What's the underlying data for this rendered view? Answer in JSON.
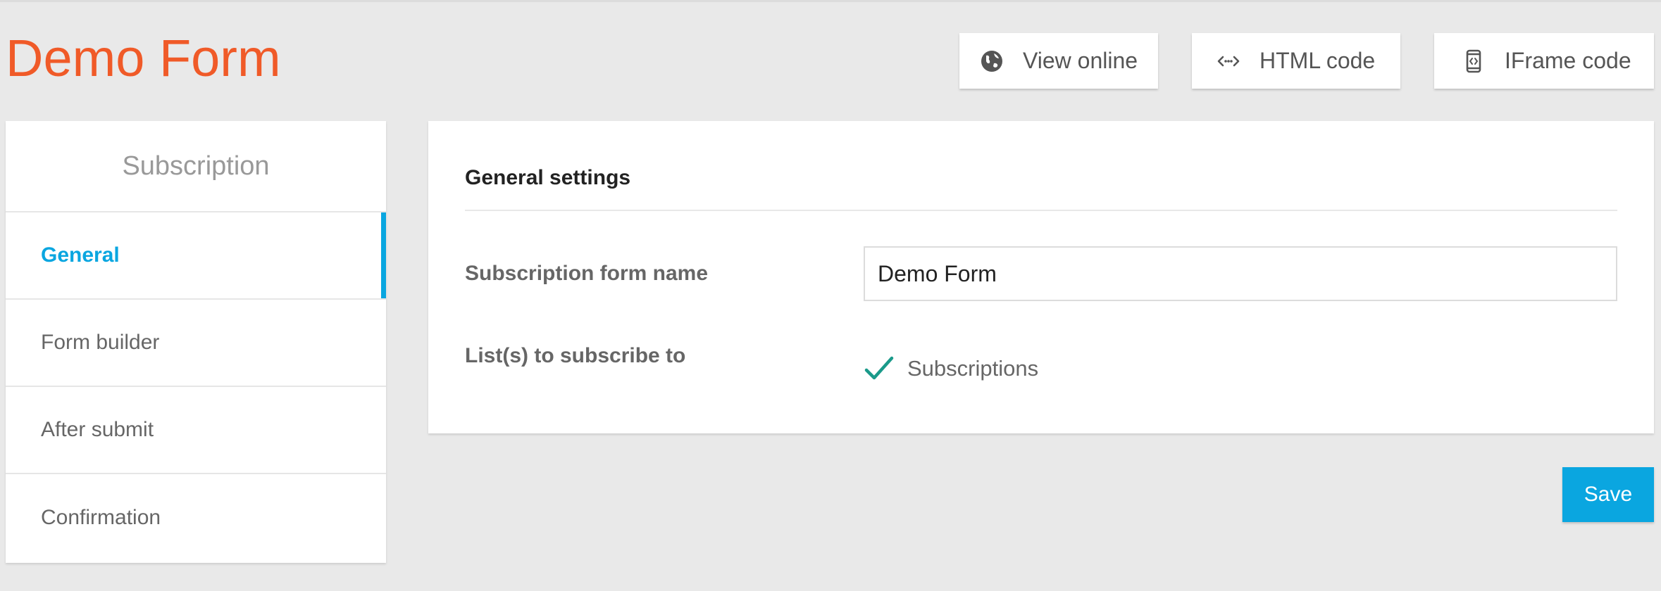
{
  "page": {
    "title": "Demo Form"
  },
  "toolbar": {
    "view_online": {
      "label": "View online",
      "icon": "globe-icon"
    },
    "html_code": {
      "label": "HTML code",
      "icon": "code-icon"
    },
    "iframe_code": {
      "label": "IFrame code",
      "icon": "iframe-device-icon"
    }
  },
  "sidebar": {
    "header": "Subscription",
    "items": [
      {
        "label": "General",
        "active": true
      },
      {
        "label": "Form builder",
        "active": false
      },
      {
        "label": "After submit",
        "active": false
      },
      {
        "label": "Confirmation",
        "active": false
      }
    ]
  },
  "general_settings": {
    "title": "General settings",
    "form_name_label": "Subscription form name",
    "form_name_value": "Demo Form",
    "lists_label": "List(s) to subscribe to",
    "lists": [
      {
        "name": "Subscriptions",
        "checked": true
      }
    ]
  },
  "actions": {
    "save_label": "Save"
  },
  "colors": {
    "title": "#f05a28",
    "accent": "#0aa6e0",
    "check": "#1a9a8a",
    "background": "#e9e9e9"
  }
}
